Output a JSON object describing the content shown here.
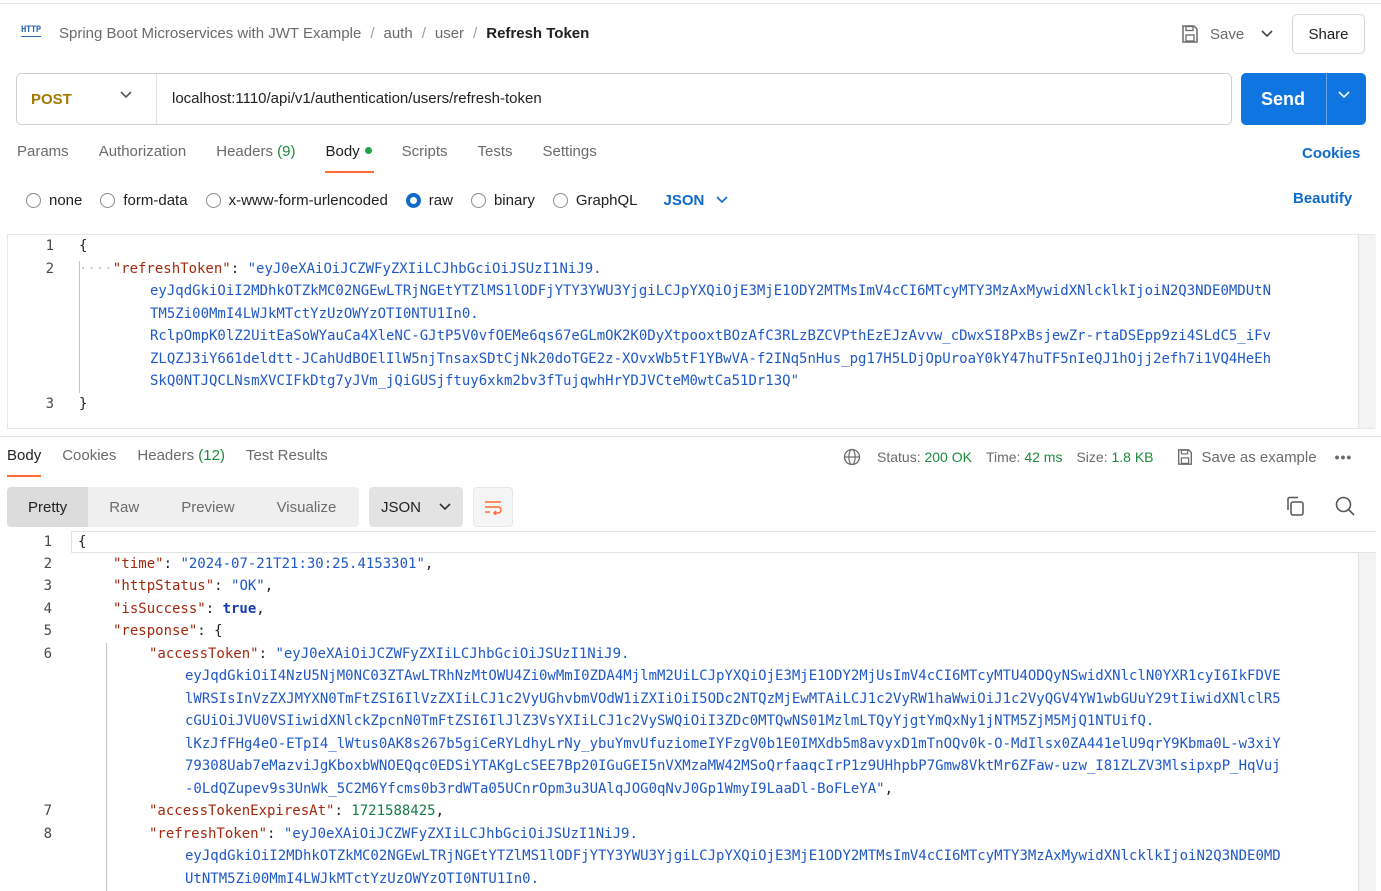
{
  "header": {
    "icon_text": "HTTP",
    "breadcrumb": [
      "Spring Boot Microservices with JWT Example",
      "auth",
      "user"
    ],
    "current": "Refresh Token",
    "save_label": "Save",
    "share_label": "Share"
  },
  "request": {
    "method": "POST",
    "url": "localhost:1110/api/v1/authentication/users/refresh-token",
    "send_label": "Send",
    "tabs": [
      {
        "label": "Params"
      },
      {
        "label": "Authorization"
      },
      {
        "label": "Headers",
        "count": "(9)"
      },
      {
        "label": "Body"
      },
      {
        "label": "Scripts"
      },
      {
        "label": "Tests"
      },
      {
        "label": "Settings"
      }
    ],
    "cookies_label": "Cookies",
    "body_types": [
      "none",
      "form-data",
      "x-www-form-urlencoded",
      "raw",
      "binary",
      "GraphQL"
    ],
    "selected_body_type": "raw",
    "format": "JSON",
    "beautify_label": "Beautify",
    "body_lines": {
      "l1": "{",
      "l2_key": "\"refreshToken\"",
      "l2_val": "\"eyJ0eXAiOiJCZWFyZXIiLCJhbGciOiJSUzI1NiJ9.",
      "l2_w1": "eyJqdGkiOiI2MDhkOTZkMC02NGEwLTRjNGEtYTZlMS1lODFjYTY3YWU3YjgiLCJpYXQiOjE3MjE1ODY2MTMsImV4cCI6MTcyMTY3MzAxMywidXNlcklkIjoiN2Q3NDE0MDUtN",
      "l2_w2": "TM5Zi00MmI4LWJkMTctYzUzOWYzOTI0NTU1In0.",
      "l2_w3": "RclpOmpK0lZ2UitEaSoWYauCa4XleNC-GJtP5V0vfOEMe6qs67eGLmOK2K0DyXtpooxtBOzAfC3RLzBZCVPthEzEJzAvvw_cDwxSI8PxBsjewZr-rtaDSEpp9zi4SLdC5_iFv",
      "l2_w4": "ZLQZJ3iY661deldtt-JCahUdBOElIlW5njTnsaxSDtCjNk20doTGE2z-XOvxWb5tF1YBwVA-f2INq5nHus_pg17H5LDjOpUroaY0kY47huTF5nIeQJ1hOjj2efh7i1VQ4HeEh",
      "l2_w5": "SkQ0NTJQCLNsmXVCIFkDtg7yJVm_jQiGUSjftuy6xkm2bv3fTujqwhHrYDJVCteM0wtCa51Dr13Q\"",
      "l3": "}"
    }
  },
  "response": {
    "tabs": [
      {
        "label": "Body"
      },
      {
        "label": "Cookies"
      },
      {
        "label": "Headers",
        "count": "(12)"
      },
      {
        "label": "Test Results"
      }
    ],
    "status_label": "Status:",
    "status_value": "200 OK",
    "time_label": "Time:",
    "time_value": "42 ms",
    "size_label": "Size:",
    "size_value": "1.8 KB",
    "save_example_label": "Save as example",
    "view_tabs": [
      "Pretty",
      "Raw",
      "Preview",
      "Visualize"
    ],
    "format": "JSON",
    "lines": {
      "time_key": "\"time\"",
      "time_val": "\"2024-07-21T21:30:25.4153301\"",
      "http_key": "\"httpStatus\"",
      "http_val": "\"OK\"",
      "success_key": "\"isSuccess\"",
      "success_val": "true",
      "response_key": "\"response\"",
      "access_key": "\"accessToken\"",
      "access_val": "\"eyJ0eXAiOiJCZWFyZXIiLCJhbGciOiJSUzI1NiJ9.",
      "access_w1": "eyJqdGkiOiI4NzU5NjM0NC03ZTAwLTRhNzMtOWU4Zi0wMmI0ZDA4MjlmM2UiLCJpYXQiOjE3MjE1ODY2MjUsImV4cCI6MTcyMTU4ODQyNSwidXNlclN0YXR1cyI6IkFDVE",
      "access_w2": "lWRSIsInVzZXJMYXN0TmFtZSI6IlVzZXIiLCJ1c2VyUGhvbmVOdW1iZXIiOiI5ODc2NTQzMjEwMTAiLCJ1c2VyRW1haWwiOiJ1c2VyQGV4YW1wbGUuY29tIiwidXNlclR5",
      "access_w3": "cGUiOiJVU0VSIiwidXNlckZpcnN0TmFtZSI6IlJlZ3VsYXIiLCJ1c2VySWQiOiI3ZDc0MTQwNS01MzlmLTQyYjgtYmQxNy1jNTM5ZjM5MjQ1NTUifQ.",
      "access_w4": "lKzJfFHg4eO-ETpI4_lWtus0AK8s267b5giCeRYLdhyLrNy_ybuYmvUfuziomeIYFzgV0b1E0IMXdb5m8avyxD1mTnOQv0k-O-MdIlsx0ZA441elU9qrY9Kbma0L-w3xiY",
      "access_w5": "79308Uab7eMazviJgKboxbWNOEQqc0EDSiYTAKgLcSEE7Bp20IGuGEI5nVXMzaMW42MSoQrfaaqcIrP1z9UHhpbP7Gmw8VktMr6ZFaw-uzw_I81ZLZV3MlsipxpP_HqVuj",
      "access_w6": "-0LdQZupev9s3UnWk_5C2M6Yfcms0b3rdWTa05UCnrOpm3u3UAlqJOG0qNvJ0Gp1WmyI9LaaDl-BoFLeYA\"",
      "exp_key": "\"accessTokenExpiresAt\"",
      "exp_val": "1721588425",
      "refresh_key": "\"refreshToken\"",
      "refresh_val": "\"eyJ0eXAiOiJCZWFyZXIiLCJhbGciOiJSUzI1NiJ9.",
      "refresh_w1": "eyJqdGkiOiI2MDhkOTZkMC02NGEwLTRjNGEtYTZlMS1lODFjYTY3YWU3YjgiLCJpYXQiOjE3MjE1ODY2MTMsImV4cCI6MTcyMTY3MzAxMywidXNlcklkIjoiN2Q3NDE0MD",
      "refresh_w2": "UtNTM5Zi00MmI4LWJkMTctYzUzOWYzOTI0NTU1In0."
    }
  },
  "colors": {
    "accent": "#ff6c37",
    "send": "#0f75e0",
    "link": "#0f6ac9",
    "ok": "#1e8a3c",
    "method": "#a37a00"
  }
}
